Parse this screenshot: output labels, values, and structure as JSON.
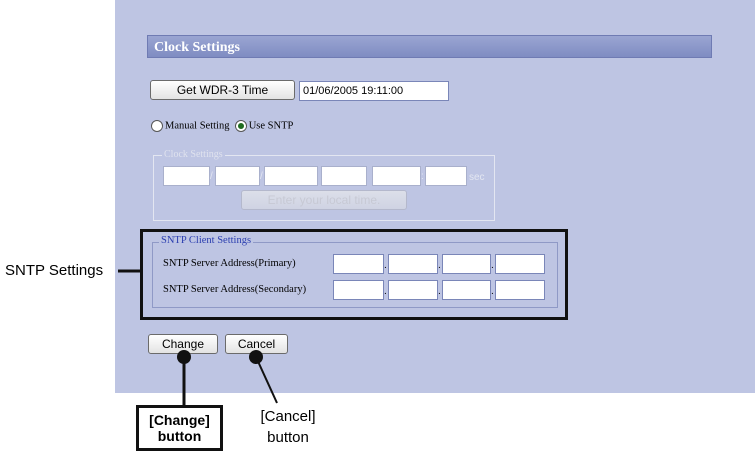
{
  "header": {
    "title": "Clock Settings"
  },
  "get_time": {
    "button_label": "Get WDR-3 Time",
    "current_time": "01/06/2005 19:11:00"
  },
  "mode": {
    "manual_label": "Manual Setting",
    "sntp_label": "Use SNTP",
    "selected": "Use SNTP"
  },
  "clock_settings": {
    "legend": "Clock Settings",
    "separators": [
      "/",
      "/",
      "",
      "",
      ":"
    ],
    "sec_label": "sec",
    "enter_button": "Enter your local time."
  },
  "sntp": {
    "legend": "SNTP Client Settings",
    "primary_label": "SNTP Server Address(Primary)",
    "secondary_label": "SNTP Server Address(Secondary)",
    "separator": "."
  },
  "actions": {
    "change_label": "Change",
    "cancel_label": "Cancel"
  },
  "callouts": {
    "sntp_settings": "SNTP Settings",
    "change_line1": "[Change]",
    "change_line2": "button",
    "cancel_line1": "[Cancel]",
    "cancel_line2": "button"
  },
  "colors": {
    "panel": "#bec5e3",
    "title_bar": "#8a96c9",
    "legend_blue": "#2c3fb0"
  }
}
